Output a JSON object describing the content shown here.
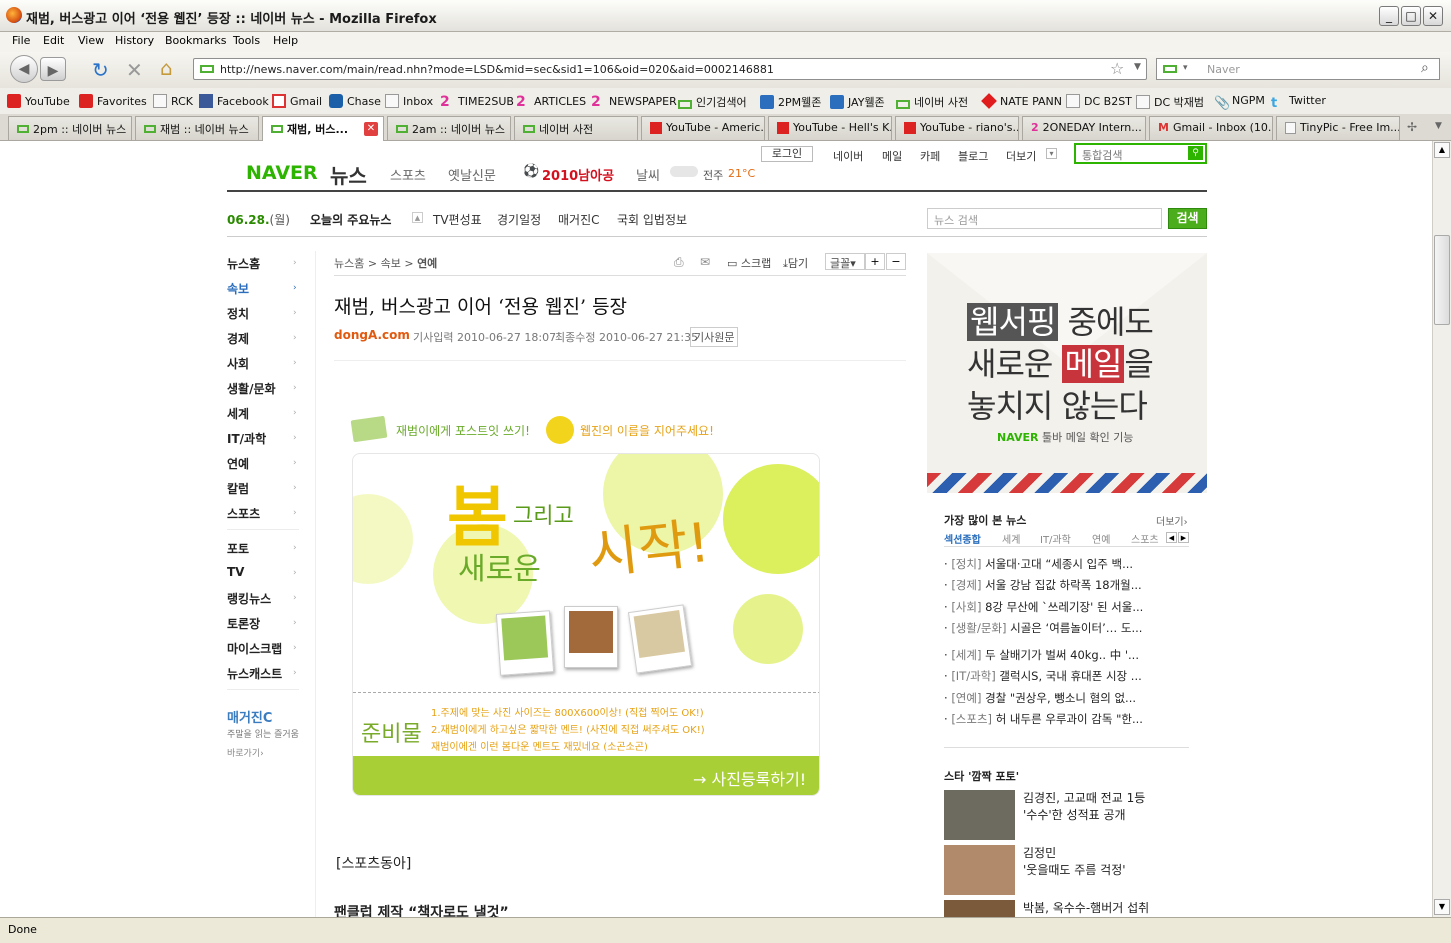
{
  "window": {
    "title": "재범, 버스광고 이어 ‘전용 웹진’ 등장 :: 네이버 뉴스 - Mozilla Firefox",
    "min": "_",
    "max": "□",
    "close": "✕"
  },
  "menu": [
    "File",
    "Edit",
    "View",
    "History",
    "Bookmarks",
    "Tools",
    "Help"
  ],
  "nav": {
    "url": "http://news.naver.com/main/read.nhn?mode=LSD&mid=sec&sid1=106&oid=020&aid=0002146881",
    "search_placeholder": "Naver"
  },
  "bookmarks": [
    "YouTube",
    "Favorites",
    "RCK",
    "Facebook",
    "Gmail",
    "Chase",
    "Inbox",
    "TIME2SUB",
    "ARTICLES",
    "NEWSPAPER",
    "인기검색어",
    "2PM웰존",
    "JAY웰존",
    "네이버 사전",
    "NATE PANN",
    "DC B2ST",
    "DC 박재범",
    "NGPM",
    "Twitter"
  ],
  "tabs": [
    "2pm :: 네이버 뉴스",
    "재범 :: 네이버 뉴스",
    "재범, 버스...",
    "2am :: 네이버 뉴스",
    "네이버 사전",
    "YouTube - Americ...",
    "YouTube - Hell's K...",
    "YouTube - riano's...",
    "2ONEDAY Intern...",
    "Gmail - Inbox (10...",
    "TinyPic - Free Im..."
  ],
  "status": "Done",
  "naver": {
    "logo": "NAVER",
    "logo_news": "뉴스",
    "sections": [
      "스포츠",
      "옛날신문",
      "2010남아공",
      "날씨"
    ],
    "weather": "전주",
    "temp": "21°C",
    "login": "로그인",
    "top_links": [
      "네이버",
      "메일",
      "카페",
      "블로그",
      "더보기"
    ],
    "top_search_placeholder": "통합검색",
    "date": "06.28.",
    "weekday": "(월)",
    "sub_links": [
      "오늘의 주요뉴스",
      "TV편성표",
      "경기일정",
      "매거진C",
      "국회 입법정보"
    ],
    "news_search_placeholder": "뉴스 검색",
    "news_search_btn": "검색",
    "lnb": [
      "뉴스홈",
      "속보",
      "정치",
      "경제",
      "사회",
      "생활/문화",
      "세계",
      "IT/과학",
      "연예",
      "칼럼",
      "스포츠",
      "포토",
      "TV",
      "랭킹뉴스",
      "토론장",
      "마이스크랩",
      "뉴스캐스트"
    ],
    "magazine": {
      "title": "매거진C",
      "desc": "주말을 읽는 즐거움",
      "go": "바로가기"
    },
    "breadcrumb": [
      "뉴스홈",
      "속보",
      "연예"
    ],
    "tools": [
      "스크랩",
      "담기",
      "글꼴",
      "+",
      "−"
    ],
    "article": {
      "title": "재범, 버스광고 이어 ‘전용 웹진’ 등장",
      "source": "dongA.com",
      "input": "기사입력 2010-06-27 18:07",
      "modified": "최종수정 2010-06-27 21:35",
      "original": "기사원문",
      "promo_top1": "재범이에게 포스트잇 쓰기!",
      "promo_top2": "웹진의 이름을 지어주세요!",
      "promo_main1": "봄",
      "promo_main2": "그리고",
      "promo_main3": "새로운",
      "promo_main4": "시작!",
      "promo_prep": "준비물",
      "promo_line1": "1.주제에 맞는 사진 사이즈는 800X600이상! (직접 찍어도 OK!)",
      "promo_line2": "2.재범이에게 하고싶은 짧막한 멘트! (사진에 직접 써주셔도 OK!)",
      "promo_line3": "재범이에겐 이런 봄다운 멘트도 재밌네요 (소곤소곤)",
      "promo_btn": "→ 사진등록하기!",
      "body1": "[스포츠동아]",
      "body2": "팬클럽 제작 “책자로도 낼것”"
    },
    "ad": {
      "line1a": "웹서핑",
      "line1b": " 중에도",
      "line2a": "새로운 ",
      "line2b": "메일",
      "line2c": "을",
      "line3": "놓치지 않는다",
      "sub_logo": "NAVER",
      "sub": " 툴바 메일 확인 기능"
    },
    "most_read": {
      "title": "가장 많이 본 뉴스",
      "more": "더보기",
      "tabs": [
        "섹션종합",
        "세계",
        "IT/과학",
        "연예",
        "스포츠"
      ],
      "items": [
        {
          "cat": "[정치]",
          "text": "서울대·고대 “세종시 입주 백..."
        },
        {
          "cat": "[경제]",
          "text": "서울 강남 집값 하락폭 18개월..."
        },
        {
          "cat": "[사회]",
          "text": "8강 무산에 `쓰레기장' 된 서울..."
        },
        {
          "cat": "[생활/문화]",
          "text": "시골은 ‘여름놀이터’… 도..."
        },
        {
          "cat": "[세계]",
          "text": "두 살배기가 벌써 40kg.. 中 '..."
        },
        {
          "cat": "[IT/과학]",
          "text": "갤럭시S, 국내 휴대폰 시장 ..."
        },
        {
          "cat": "[연예]",
          "text": "경찰 \"권상우, 뺑소니 혐의 없..."
        },
        {
          "cat": "[스포츠]",
          "text": "허 내두른 우루과이 감독 \"한..."
        }
      ]
    },
    "star": {
      "title": "스타 '깜짝 포토'",
      "items": [
        {
          "name": "김경진, 고교때 전교 1등",
          "desc": "'수수'한 성적표 공개"
        },
        {
          "name": "김정민",
          "desc": "'웃을때도 주름 걱정'"
        },
        {
          "name": "박봄, 옥수수-햄버거 섭취",
          "desc": ""
        }
      ]
    }
  }
}
